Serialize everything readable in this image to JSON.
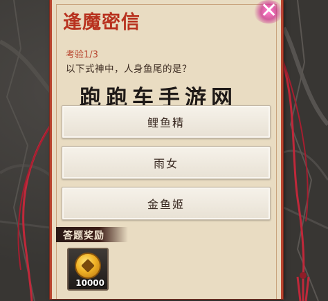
{
  "letter": {
    "title": "逢魔密信",
    "exam_label": "考验1/3",
    "question": "以下式神中，人身鱼尾的是？",
    "watermark": "跑跑车手游网"
  },
  "options": [
    {
      "label": "鲤鱼精"
    },
    {
      "label": "雨女"
    },
    {
      "label": "金鱼姬"
    }
  ],
  "reward": {
    "banner": "答题奖励",
    "item_icon": "gold-coin-icon",
    "count": "10000"
  },
  "close_icon": "close-icon",
  "colors": {
    "title_red": "#b8321f",
    "panel_bg": "#e9dcc2",
    "tassel_red": "#c0283a"
  }
}
